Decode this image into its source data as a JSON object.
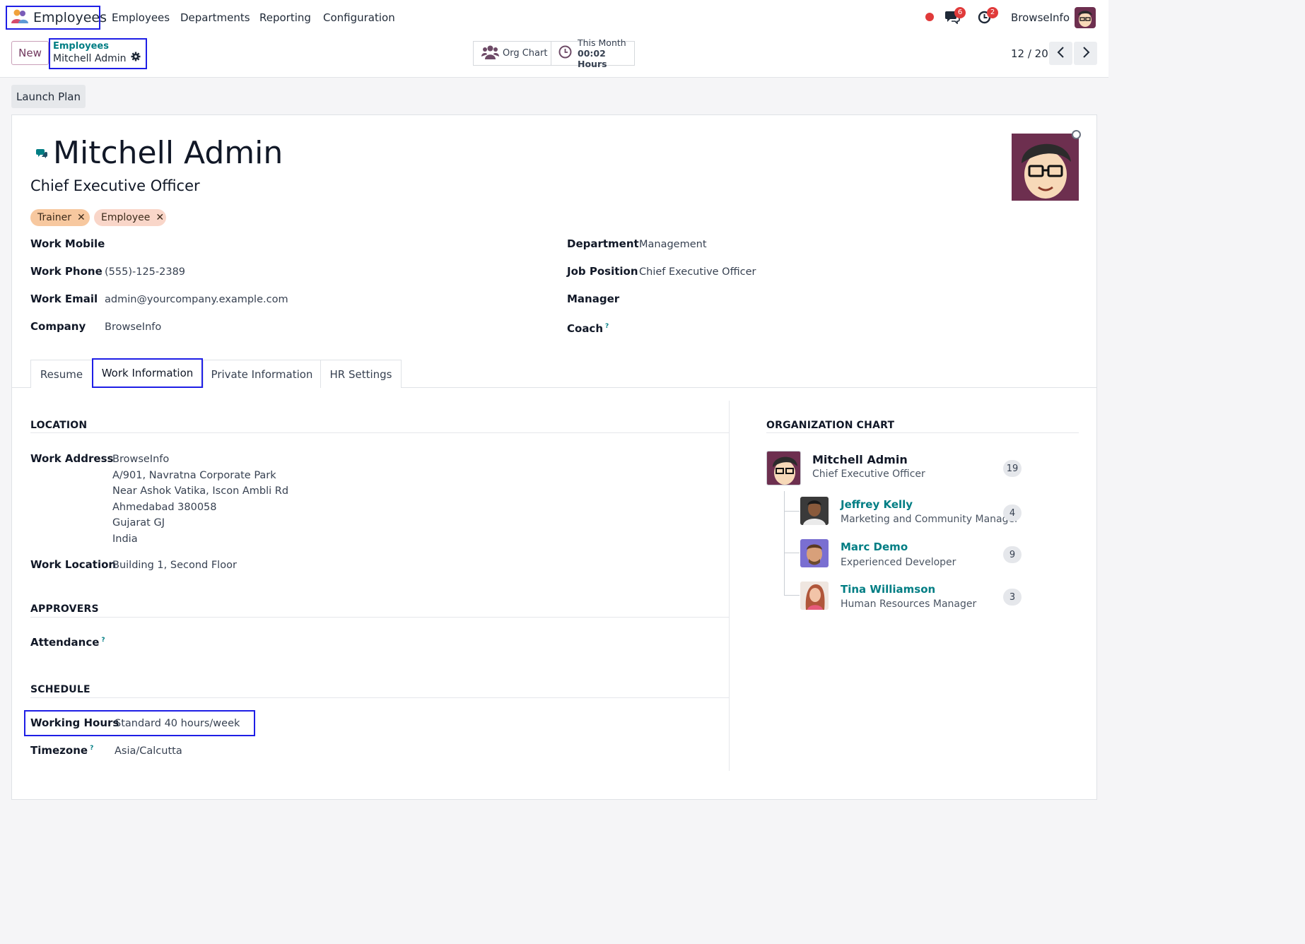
{
  "nav": {
    "app_name": "Employees",
    "menu": [
      "Employees",
      "Departments",
      "Reporting",
      "Configuration"
    ],
    "messages_count": "6",
    "activities_count": "2",
    "company": "BrowseInfo"
  },
  "control": {
    "new_label": "New",
    "breadcrumb_parent": "Employees",
    "breadcrumb_current": "Mitchell Admin",
    "org_chart_label": "Org Chart",
    "timesheet_period": "This Month",
    "timesheet_hours": "00:02 Hours",
    "pager": "12 / 20"
  },
  "launch_plan_label": "Launch Plan",
  "employee": {
    "name": "Mitchell Admin",
    "job_title": "Chief Executive Officer",
    "tags": [
      {
        "label": "Trainer",
        "color": "#f7c89f"
      },
      {
        "label": "Employee",
        "color": "#f9d6c9"
      }
    ]
  },
  "fields_left": {
    "work_mobile_label": "Work Mobile",
    "work_mobile": "",
    "work_phone_label": "Work Phone",
    "work_phone": "(555)-125-2389",
    "work_email_label": "Work Email",
    "work_email": "admin@yourcompany.example.com",
    "company_label": "Company",
    "company": "BrowseInfo"
  },
  "fields_right": {
    "department_label": "Department",
    "department": "Management",
    "job_position_label": "Job Position",
    "job_position": "Chief Executive Officer",
    "manager_label": "Manager",
    "manager": "",
    "coach_label": "Coach",
    "coach": ""
  },
  "tabs": [
    "Resume",
    "Work Information",
    "Private Information",
    "HR Settings"
  ],
  "work_info": {
    "location_title": "LOCATION",
    "work_address_label": "Work Address",
    "work_address_lines": [
      "BrowseInfo",
      "A/901, Navratna Corporate Park",
      "Near Ashok Vatika, Iscon Ambli Rd",
      "Ahmedabad 380058",
      "Gujarat GJ",
      "India"
    ],
    "work_location_label": "Work Location",
    "work_location": "Building 1, Second Floor",
    "approvers_title": "APPROVERS",
    "attendance_label": "Attendance",
    "schedule_title": "SCHEDULE",
    "working_hours_label": "Working Hours",
    "working_hours": "Standard 40 hours/week",
    "timezone_label": "Timezone",
    "timezone": "Asia/Calcutta"
  },
  "org_chart": {
    "title": "ORGANIZATION CHART",
    "self": {
      "name": "Mitchell Admin",
      "job": "Chief Executive Officer",
      "count": "19"
    },
    "subordinates": [
      {
        "name": "Jeffrey Kelly",
        "job": "Marketing and Community Manager",
        "count": "4"
      },
      {
        "name": "Marc Demo",
        "job": "Experienced Developer",
        "count": "9"
      },
      {
        "name": "Tina Williamson",
        "job": "Human Resources Manager",
        "count": "3"
      }
    ]
  },
  "help_mark": "?"
}
